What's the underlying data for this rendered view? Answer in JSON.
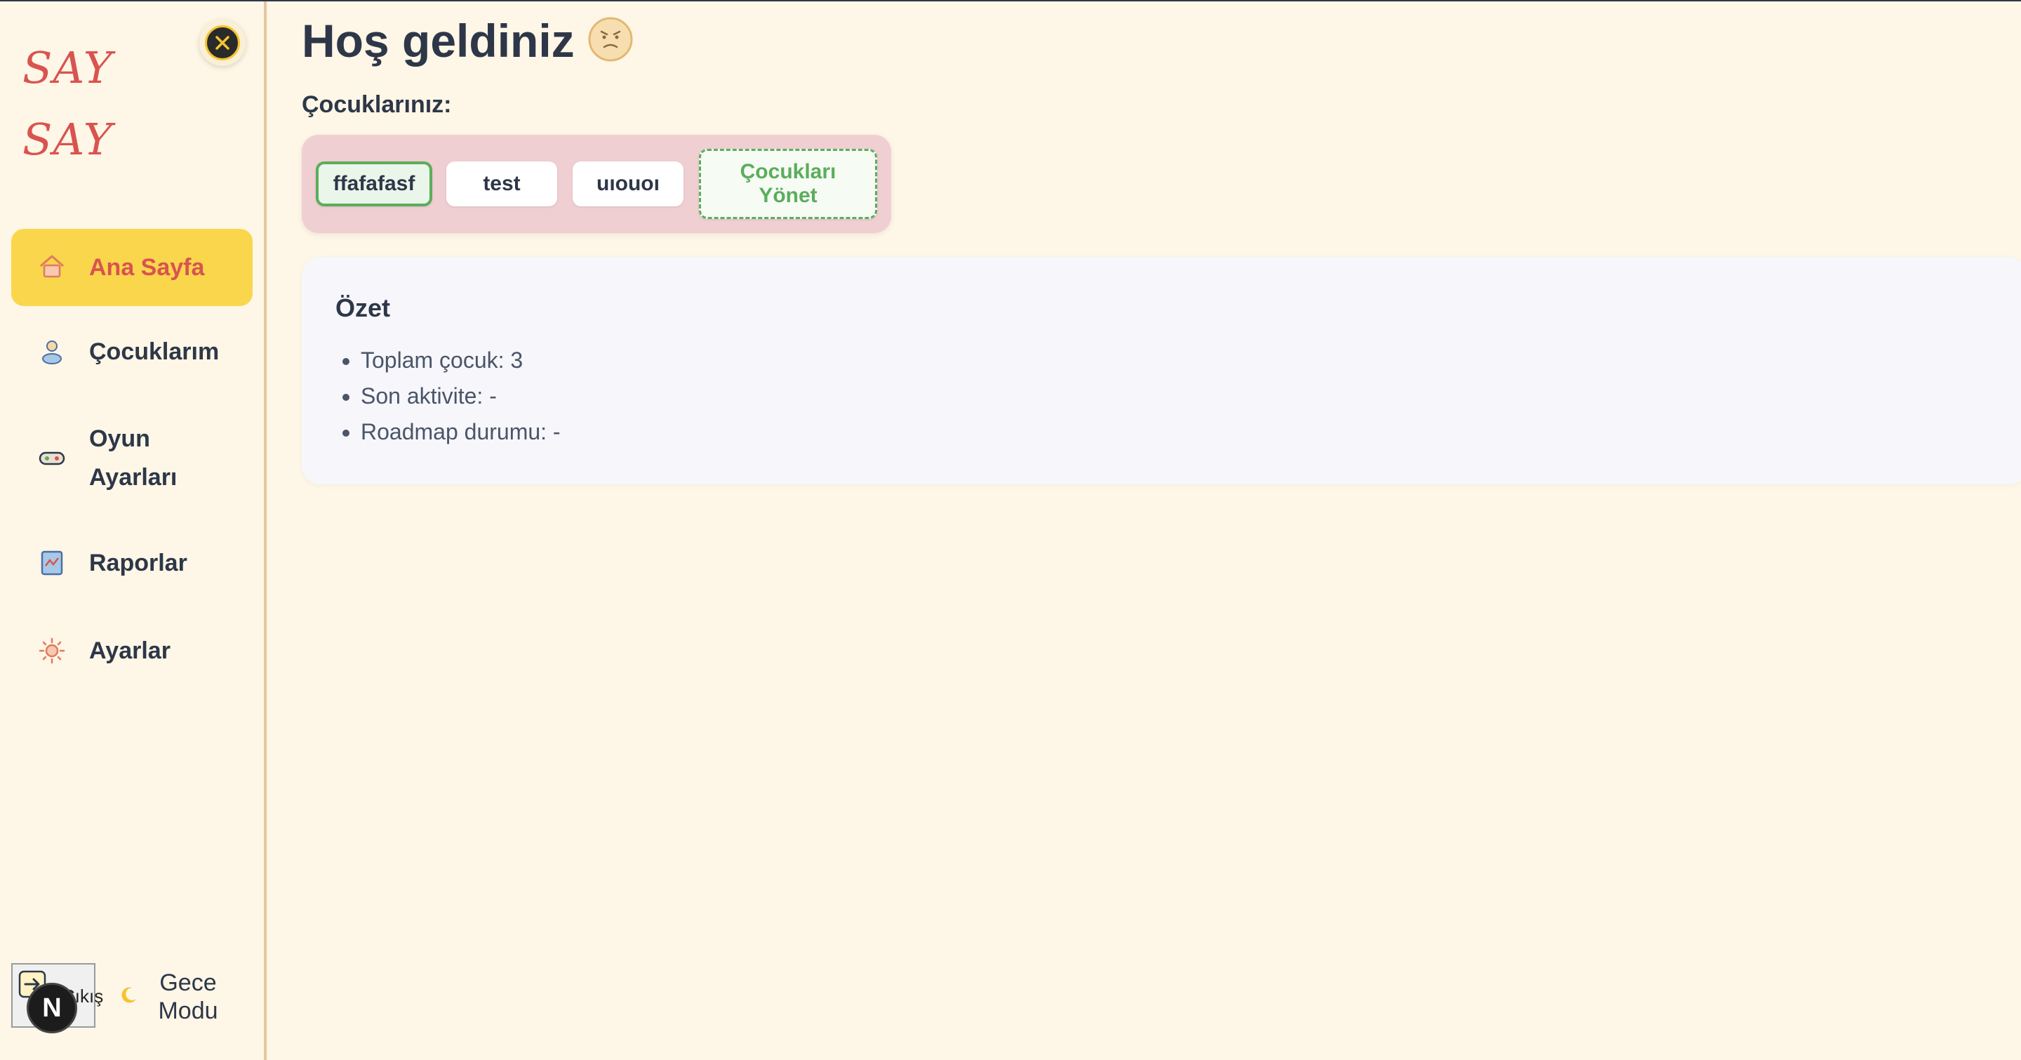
{
  "app": {
    "logo_line1": "SAY",
    "logo_line2": "SAY"
  },
  "sidebar": {
    "items": [
      {
        "label": "Ana Sayfa",
        "icon": "home-icon",
        "active": true
      },
      {
        "label": "Çocuklarım",
        "icon": "user-icon"
      },
      {
        "label": "Oyun Ayarları",
        "icon": "gamepad-icon"
      },
      {
        "label": "Raporlar",
        "icon": "report-icon"
      },
      {
        "label": "Ayarlar",
        "icon": "gear-icon"
      }
    ],
    "exit_label": "Çıkış",
    "night_mode_label": "Gece Modu",
    "badge_letter": "N"
  },
  "main": {
    "welcome_title": "Hoş geldiniz",
    "kids_label": "Çocuklarınız:",
    "kids": [
      "ffafafasf",
      "test",
      "uıouoı"
    ],
    "selected_kid": "ffafafasf",
    "manage_label_line1": "Çocukları",
    "manage_label_line2": "Yönet",
    "summary": {
      "title": "Özet",
      "items": [
        "Toplam çocuk: 3",
        "Son aktivite: -",
        "Roadmap durumu: -"
      ]
    }
  },
  "colors": {
    "background": "#fef6e6",
    "active_nav": "#f9d64c",
    "accent_red": "#d9534f",
    "kids_box": "#f0cfd3",
    "green": "#5cad5c"
  }
}
